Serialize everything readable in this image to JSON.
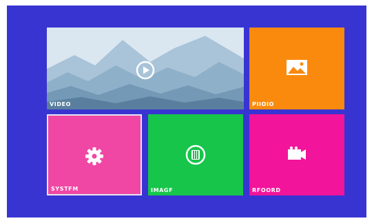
{
  "menu": {
    "tiles": [
      {
        "id": "video",
        "label": "VIDEO",
        "color": "#c5d8e6",
        "icon": "play-icon"
      },
      {
        "id": "photo",
        "label": "PIIOIO",
        "color": "#fa8a0e",
        "icon": "picture-icon"
      },
      {
        "id": "system",
        "label": "SYSTFM",
        "color": "#f047a4",
        "icon": "gear-icon"
      },
      {
        "id": "image",
        "label": "IMAGF",
        "color": "#17c54b",
        "icon": "film-icon"
      },
      {
        "id": "record",
        "label": "RFOORD",
        "color": "#f2149a",
        "icon": "camera-icon"
      }
    ]
  },
  "colors": {
    "background": "#3834d2",
    "selection_border": "#e6e6f0"
  }
}
